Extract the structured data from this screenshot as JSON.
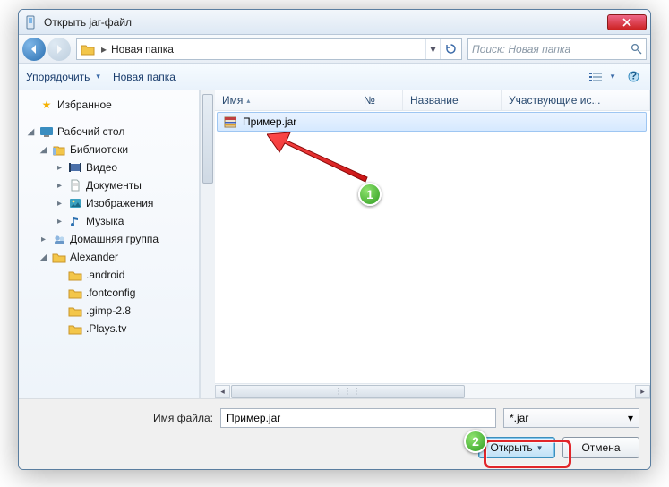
{
  "window": {
    "title": "Открыть jar-файл"
  },
  "nav": {
    "crumb": "Новая папка",
    "search_placeholder": "Поиск: Новая папка"
  },
  "toolbar": {
    "organize": "Упорядочить",
    "newfolder": "Новая папка"
  },
  "tree": {
    "favorites": "Избранное",
    "desktop": "Рабочий стол",
    "libraries": "Библиотеки",
    "videos": "Видео",
    "documents": "Документы",
    "pictures": "Изображения",
    "music": "Музыка",
    "homegroup": "Домашняя группа",
    "user": "Alexander",
    "f_android": ".android",
    "f_fontconfig": ".fontconfig",
    "f_gimp": ".gimp-2.8",
    "f_plays": ".Plays.tv"
  },
  "columns": {
    "name": "Имя",
    "num": "№",
    "title": "Название",
    "part": "Участвующие ис..."
  },
  "file": {
    "name": "Пример.jar"
  },
  "footer": {
    "filename_label": "Имя файла:",
    "filename_value": "Пример.jar",
    "filter": "*.jar",
    "open": "Открыть",
    "cancel": "Отмена"
  },
  "annot": {
    "step1": "1",
    "step2": "2"
  }
}
